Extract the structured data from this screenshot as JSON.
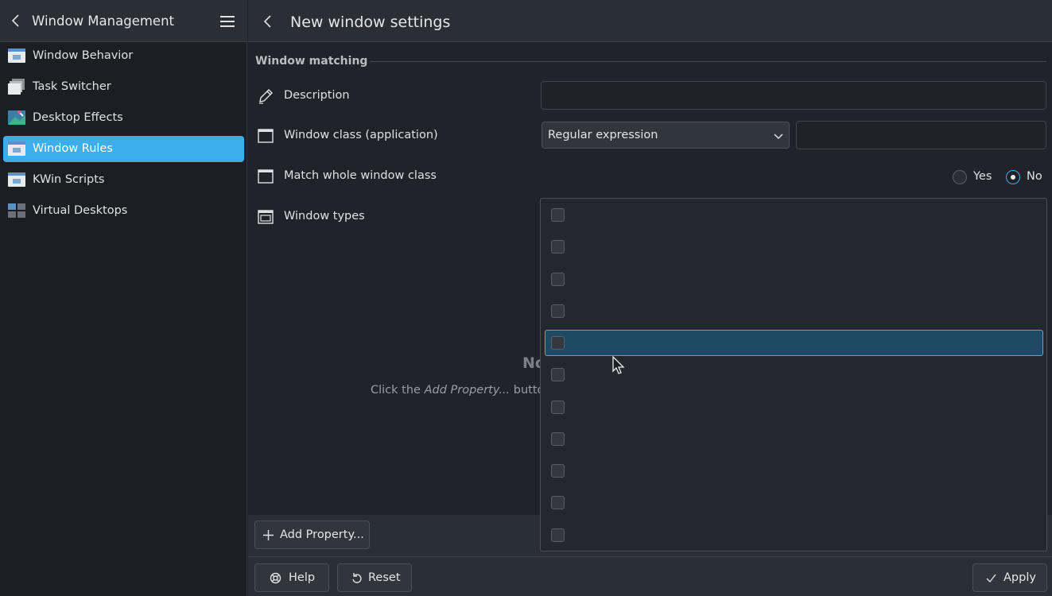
{
  "sidebar": {
    "title": "Window Management",
    "items": [
      {
        "label": "Window Behavior",
        "icon": "window-behavior-icon"
      },
      {
        "label": "Task Switcher",
        "icon": "task-switcher-icon"
      },
      {
        "label": "Desktop Effects",
        "icon": "desktop-effects-icon"
      },
      {
        "label": "Window Rules",
        "icon": "window-rules-icon",
        "active": true
      },
      {
        "label": "KWin Scripts",
        "icon": "kwin-scripts-icon"
      },
      {
        "label": "Virtual Desktops",
        "icon": "virtual-desktops-icon"
      }
    ]
  },
  "header": {
    "title": "New window settings"
  },
  "matching": {
    "section_title": "Window matching",
    "description_label": "Description",
    "description_value": "",
    "window_class_label": "Window class (application)",
    "window_class_mode": "Regular expression",
    "window_class_value": "",
    "match_whole_label": "Match whole window class",
    "yes_label": "Yes",
    "no_label": "No",
    "selected": "No",
    "window_types_label": "Window types"
  },
  "empty_state": {
    "title": "No",
    "text_prefix": "Click the ",
    "text_em": "Add Property...",
    "text_suffix": " button"
  },
  "window_types_list": {
    "item_count": 11,
    "highlighted_index": 4
  },
  "buttons": {
    "add_property": "Add Property...",
    "help": "Help",
    "reset": "Reset",
    "apply": "Apply"
  },
  "colors": {
    "accent": "#3daee9",
    "background": "#20232a",
    "sidebar": "#1b1e23"
  }
}
